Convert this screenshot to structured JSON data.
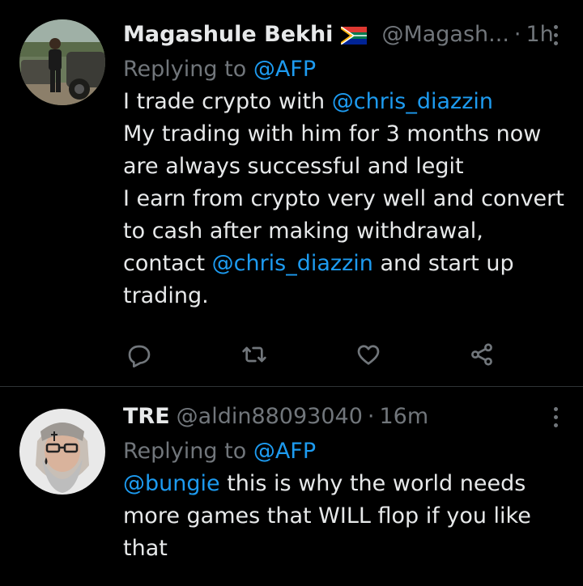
{
  "tweets": [
    {
      "display_name": "Magashule Bekhi",
      "flag_icon": "south-africa-flag-icon",
      "handle": "@Magash...",
      "separator": "·",
      "time": "1h",
      "replying_prefix": "Replying to",
      "replying_to": "@AFP",
      "lines": [
        [
          {
            "t": "I trade crypto with "
          },
          {
            "t": "@chris_diazzin",
            "m": true
          }
        ],
        [
          {
            "t": "My trading with him for 3 months now"
          }
        ],
        [
          {
            "t": "are always successful and legit"
          }
        ],
        [
          {
            "t": "I earn from crypto very well and convert"
          }
        ],
        [
          {
            "t": "to cash after making withdrawal,"
          }
        ],
        [
          {
            "t": "contact "
          },
          {
            "t": "@chris_diazzin",
            "m": true
          },
          {
            "t": " and start up"
          }
        ],
        [
          {
            "t": "trading."
          }
        ]
      ],
      "actions": [
        "reply-icon",
        "retweet-icon",
        "like-icon",
        "share-icon"
      ]
    },
    {
      "display_name": "TRE",
      "handle": "@aldin88093040",
      "separator": "·",
      "time": "16m",
      "replying_prefix": "Replying to",
      "replying_to": "@AFP",
      "lines": [
        [
          {
            "t": "@bungie",
            "m": true
          },
          {
            "t": " this is why the world needs"
          }
        ],
        [
          {
            "t": "more games that WILL flop if you like"
          }
        ],
        [
          {
            "t": "that"
          }
        ]
      ]
    }
  ],
  "colors": {
    "background": "#000000",
    "text": "#e7e9ea",
    "secondary": "#71767b",
    "link": "#1d9bf0",
    "divider": "#2f3336"
  }
}
